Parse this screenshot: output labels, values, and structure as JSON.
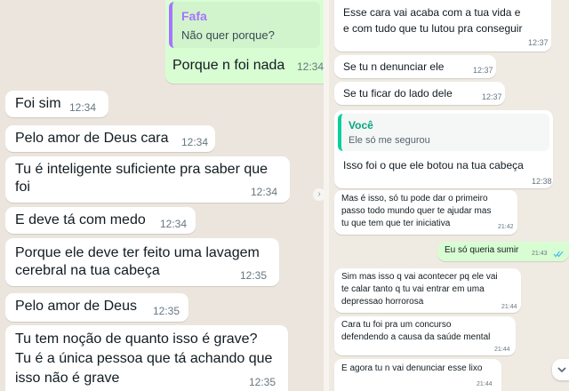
{
  "left": {
    "reply": {
      "quote_name": "Fafa",
      "quote_text": "Não quer porque?",
      "text": "Porque n foi nada",
      "time": "12:34"
    },
    "messages": [
      {
        "lines": [
          "Foi sim"
        ],
        "time": "12:34"
      },
      {
        "lines": [
          "Pelo amor de Deus cara"
        ],
        "time": "12:34"
      },
      {
        "lines": [
          "Tu é inteligente suficiente pra saber que",
          "foi"
        ],
        "time": "12:34"
      },
      {
        "lines": [
          "E deve tá com medo"
        ],
        "time": "12:34"
      },
      {
        "lines": [
          "Porque ele deve ter feito uma lavagem",
          "cerebral na tua cabeça"
        ],
        "time": "12:35"
      },
      {
        "lines": [
          "Pelo amor de Deus"
        ],
        "time": "12:35"
      },
      {
        "lines": [
          "Tu tem noção de quanto isso é grave?",
          "Tu é a única pessoa que tá achando que",
          "isso não é grave"
        ],
        "time": "12:35"
      }
    ]
  },
  "right": {
    "m1": {
      "lines": [
        "Esse cara vai acaba com a tua vida e",
        "e com tudo que tu lutou pra conseguir"
      ],
      "time": "12:37"
    },
    "m2": {
      "text": "Se tu n denunciar ele",
      "time": "12:37"
    },
    "m3": {
      "text": "Se tu ficar do lado dele",
      "time": "12:37"
    },
    "m4": {
      "quote_name": "Você",
      "quote_text": "Ele só me segurou",
      "text": "Isso foi o que ele botou na tua cabeça",
      "time": "12:38"
    },
    "m5": {
      "lines": [
        "Mas é isso, só tu pode dar o primeiro",
        "passo todo mundo quer te ajudar mas",
        "tu que tem que ter iniciativa"
      ],
      "time": "21:42"
    },
    "m6": {
      "text": "Eu só queria sumir",
      "time": "21:43"
    },
    "m7": {
      "lines": [
        "Sim mas isso q vai acontecer pq ele vai",
        "te calar tanto q tu vai entrar em uma",
        "depressao horrorosa"
      ],
      "time": "21:44"
    },
    "m8": {
      "lines": [
        "Cara tu foi pra um concurso",
        "defendendo a causa da saúde mental"
      ],
      "time": "21:44"
    },
    "m9": {
      "text": "E agora tu n vai denunciar esse lixo",
      "time": "21:44"
    }
  },
  "colors": {
    "incoming_bubble": "#ffffff",
    "outgoing_bubble": "#d9fdd3",
    "wallpaper": "#efeae2",
    "quote_accent_purple": "#a774ff",
    "quote_accent_green": "#06cf9c",
    "read_ticks": "#53bdeb"
  },
  "icons": {
    "read_receipt": "double-check-icon",
    "scroll": "chevron-down-icon",
    "forward": "chevron-right-icon"
  }
}
